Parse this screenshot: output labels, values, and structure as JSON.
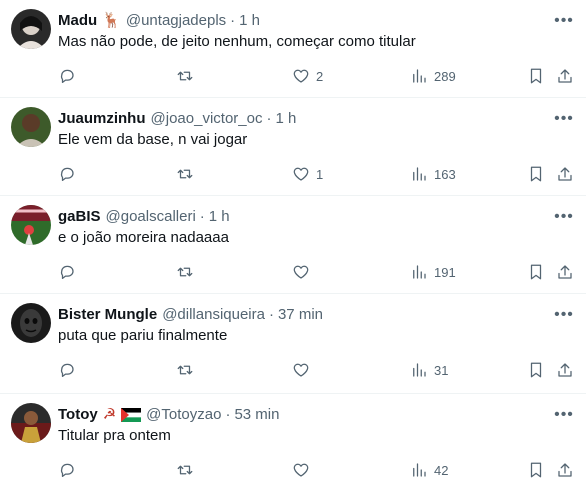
{
  "posts": [
    {
      "name": "Madu",
      "emoji": "🦌",
      "handle": "@untagjadepls",
      "time": "1 h",
      "text": "Mas não pode, de jeito nenhum, começar como titular",
      "replies": "",
      "reposts": "",
      "likes": "2",
      "views": "289",
      "avatar_color": "#2a2a2a"
    },
    {
      "name": "Juaumzinhu",
      "emoji": "",
      "handle": "@joao_victor_oc",
      "time": "1 h",
      "text": "Ele vem da base, n vai jogar",
      "replies": "",
      "reposts": "",
      "likes": "1",
      "views": "163",
      "avatar_color": "#3d5a2a"
    },
    {
      "name": "gaBIS",
      "emoji": "",
      "handle": "@goalscalleri",
      "time": "1 h",
      "text": "e o joão moreira nadaaaa",
      "replies": "",
      "reposts": "",
      "likes": "",
      "views": "191",
      "avatar_color": "#7a1f2b"
    },
    {
      "name": "Bister Mungle",
      "emoji": "",
      "handle": "@dillansiqueira",
      "time": "37 min",
      "text": "puta que pariu finalmente",
      "replies": "",
      "reposts": "",
      "likes": "",
      "views": "31",
      "avatar_color": "#1a1a1a"
    },
    {
      "name": "Totoy",
      "emoji": "☭",
      "flag": "palestine-flag",
      "handle": "@Totoyzao",
      "time": "53 min",
      "text": "Titular pra ontem",
      "replies": "",
      "reposts": "",
      "likes": "",
      "views": "42",
      "avatar_color": "#6b1a1a"
    }
  ],
  "icons": {
    "reply": "reply-icon",
    "repost": "repost-icon",
    "like": "heart-icon",
    "views": "views-icon",
    "bookmark": "bookmark-icon",
    "share": "share-icon",
    "more": "more-icon"
  },
  "colors": {
    "text": "#0f1419",
    "muted": "#536471",
    "divider": "#eff3f4"
  }
}
